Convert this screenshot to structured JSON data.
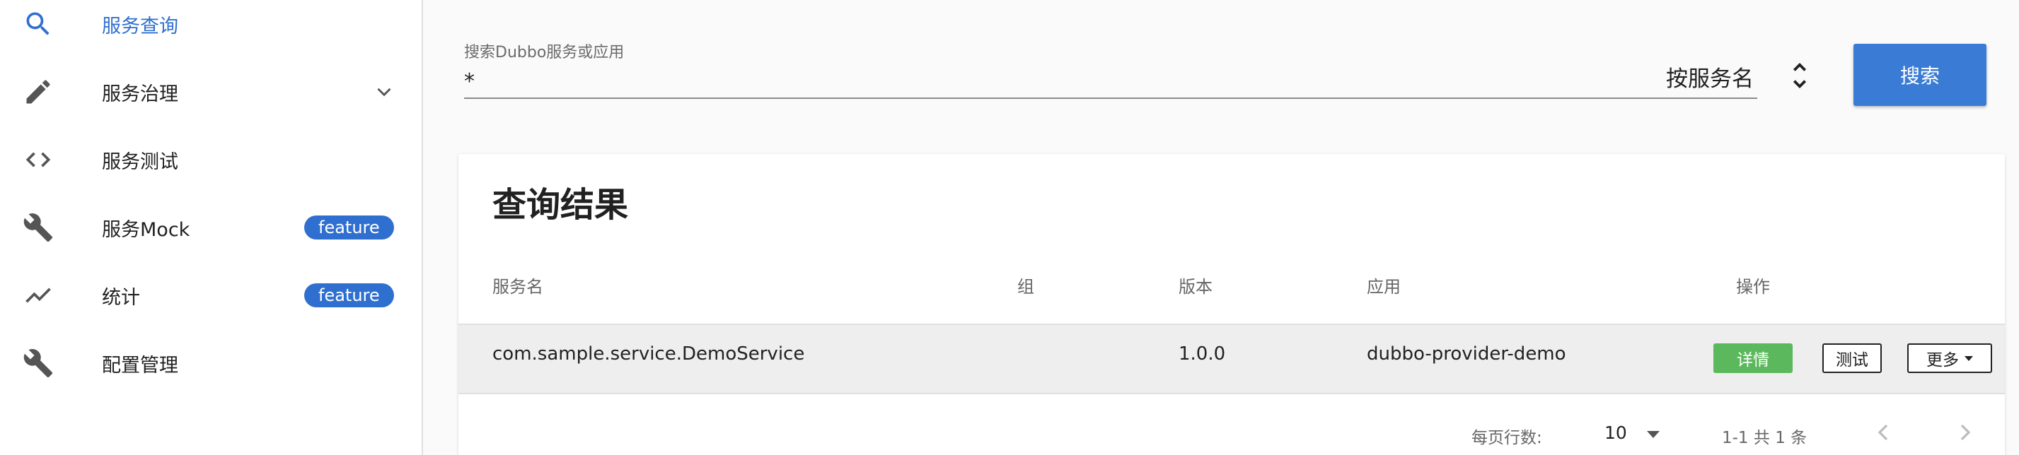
{
  "sidebar": {
    "items": [
      {
        "label": "服务查询",
        "icon": "search-icon",
        "active": true
      },
      {
        "label": "服务治理",
        "icon": "pencil-icon",
        "expandable": true
      },
      {
        "label": "服务测试",
        "icon": "code-icon"
      },
      {
        "label": "服务Mock",
        "icon": "wrench-icon",
        "badge": "feature"
      },
      {
        "label": "统计",
        "icon": "trending-icon",
        "badge": "feature"
      },
      {
        "label": "配置管理",
        "icon": "wrench-icon"
      }
    ]
  },
  "search": {
    "label": "搜索Dubbo服务或应用",
    "value": "*",
    "mode": "按服务名",
    "button": "搜索"
  },
  "results": {
    "title": "查询结果",
    "columns": [
      "服务名",
      "组",
      "版本",
      "应用",
      "操作"
    ],
    "rows": [
      {
        "service": "com.sample.service.DemoService",
        "group": "",
        "version": "1.0.0",
        "app": "dubbo-provider-demo"
      }
    ],
    "actions": {
      "detail": "详情",
      "test": "测试",
      "more": "更多"
    },
    "footer": {
      "rows_per_page_label": "每页行数:",
      "rows_per_page": "10",
      "range": "1-1 共 1 条"
    }
  },
  "colors": {
    "accent": "#2f6fcf",
    "button": "#3a7bd5",
    "detail": "#5cb85c"
  }
}
